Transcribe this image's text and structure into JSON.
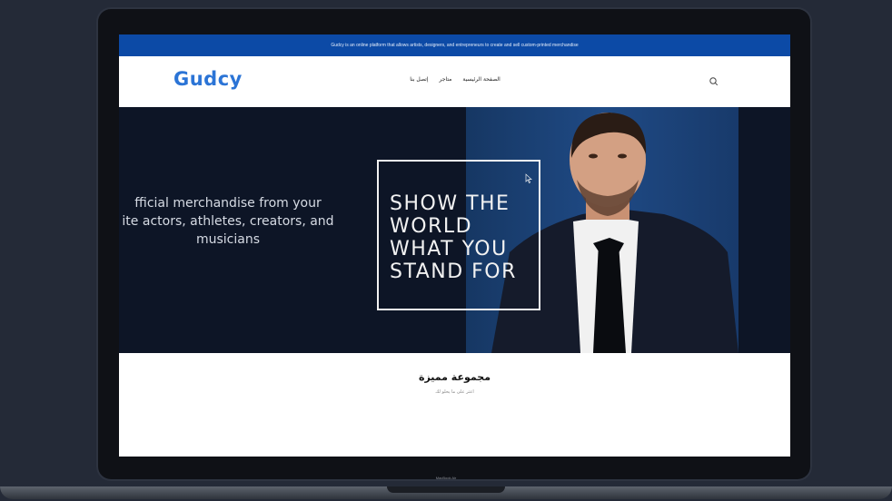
{
  "announcement": {
    "text": "Gudcy is an online platform that allows artists, designers, and entrepreneurs to create and sell custom-printed merchandise"
  },
  "header": {
    "logo_text": "Gudcy",
    "nav": [
      "الصفحة الرئيسية",
      "متاجر",
      "إتصل بنا"
    ],
    "search_icon": "search-icon"
  },
  "hero": {
    "tagline": "fficial merchandise from your ite actors, athletes, creators, and musicians",
    "tagline_lines": [
      "fficial merchandise from your",
      "ite actors, athletes, creators, and",
      "musicians"
    ],
    "heading_lines": [
      "SHOW THE",
      "WORLD",
      "WHAT YOU",
      "STAND FOR"
    ]
  },
  "featured": {
    "title": "مجموعة مميزة",
    "subtitle": "اعثر على ما يحلو لك"
  },
  "device": {
    "label": "MacBook Air"
  },
  "colors": {
    "brand_blue": "#0c4aa6",
    "logo_blue": "#2b74d6",
    "hero_bg": "#0d1526"
  }
}
